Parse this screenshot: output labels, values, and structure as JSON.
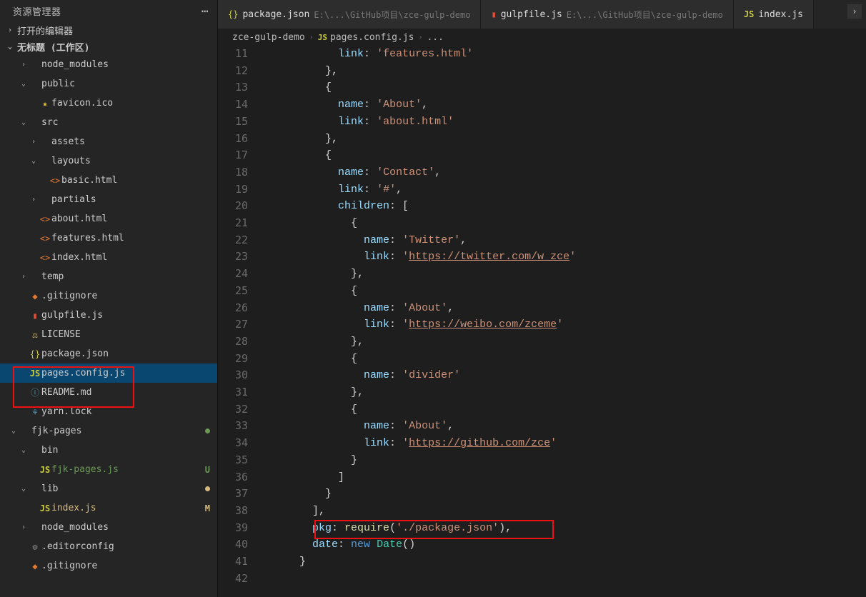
{
  "sidebar": {
    "title": "资源管理器",
    "openEditors": "打开的编辑器",
    "workspace": "无标题 (工作区)",
    "tree": [
      {
        "d": 1,
        "chev": ">",
        "icon": "",
        "cls": "ic-folder",
        "label": "node_modules"
      },
      {
        "d": 1,
        "chev": "v",
        "icon": "",
        "cls": "ic-folder",
        "label": "public"
      },
      {
        "d": 2,
        "chev": "",
        "icon": "★",
        "cls": "ic-star",
        "label": "favicon.ico"
      },
      {
        "d": 1,
        "chev": "v",
        "icon": "",
        "cls": "ic-folder",
        "label": "src"
      },
      {
        "d": 2,
        "chev": ">",
        "icon": "",
        "cls": "ic-folder",
        "label": "assets"
      },
      {
        "d": 2,
        "chev": "v",
        "icon": "",
        "cls": "ic-folder",
        "label": "layouts"
      },
      {
        "d": 3,
        "chev": "",
        "icon": "<>",
        "cls": "ic-html",
        "label": "basic.html"
      },
      {
        "d": 2,
        "chev": ">",
        "icon": "",
        "cls": "ic-folder",
        "label": "partials"
      },
      {
        "d": 2,
        "chev": "",
        "icon": "<>",
        "cls": "ic-html",
        "label": "about.html"
      },
      {
        "d": 2,
        "chev": "",
        "icon": "<>",
        "cls": "ic-html",
        "label": "features.html"
      },
      {
        "d": 2,
        "chev": "",
        "icon": "<>",
        "cls": "ic-html",
        "label": "index.html"
      },
      {
        "d": 1,
        "chev": ">",
        "icon": "",
        "cls": "ic-folder",
        "label": "temp"
      },
      {
        "d": 1,
        "chev": "",
        "icon": "◆",
        "cls": "ic-git",
        "label": ".gitignore"
      },
      {
        "d": 1,
        "chev": "",
        "icon": "▮",
        "cls": "ic-gulp",
        "label": "gulpfile.js"
      },
      {
        "d": 1,
        "chev": "",
        "icon": "⚖",
        "cls": "ic-license",
        "label": "LICENSE"
      },
      {
        "d": 1,
        "chev": "",
        "icon": "{}",
        "cls": "ic-json",
        "label": "package.json"
      },
      {
        "d": 1,
        "chev": "",
        "icon": "JS",
        "cls": "ic-js",
        "label": "pages.config.js",
        "selected": true
      },
      {
        "d": 1,
        "chev": "",
        "icon": "ⓘ",
        "cls": "ic-md",
        "label": "README.md"
      },
      {
        "d": 1,
        "chev": "",
        "icon": "⚘",
        "cls": "ic-yarn",
        "label": "yarn.lock"
      },
      {
        "d": 0,
        "chev": "v",
        "icon": "",
        "cls": "ic-folder",
        "label": "fjk-pages",
        "badge": "dot",
        "badgeColor": "#6a9955"
      },
      {
        "d": 1,
        "chev": "v",
        "icon": "",
        "cls": "ic-folder",
        "label": "bin"
      },
      {
        "d": 2,
        "chev": "",
        "icon": "JS",
        "cls": "ic-js",
        "label": "fjk-pages.js",
        "badge": "U",
        "badgeColor": "#6a9955",
        "labelColor": "#6a9955"
      },
      {
        "d": 1,
        "chev": "v",
        "icon": "",
        "cls": "ic-folder",
        "label": "lib",
        "badge": "dot",
        "badgeColor": "#d7ba7d"
      },
      {
        "d": 2,
        "chev": "",
        "icon": "JS",
        "cls": "ic-js",
        "label": "index.js",
        "badge": "M",
        "badgeColor": "#d7ba7d",
        "labelColor": "#d7ba7d"
      },
      {
        "d": 1,
        "chev": ">",
        "icon": "",
        "cls": "ic-folder",
        "label": "node_modules"
      },
      {
        "d": 1,
        "chev": "",
        "icon": "⚙",
        "cls": "ic-gear",
        "label": ".editorconfig"
      },
      {
        "d": 1,
        "chev": "",
        "icon": "◆",
        "cls": "ic-git",
        "label": ".gitignore"
      }
    ]
  },
  "tabs": [
    {
      "icon": "{}",
      "iconCls": "ic-json",
      "label": "package.json",
      "path": "E:\\...\\GitHub项目\\zce-gulp-demo",
      "active": false
    },
    {
      "icon": "▮",
      "iconCls": "ic-gulp",
      "label": "gulpfile.js",
      "path": "E:\\...\\GitHub项目\\zce-gulp-demo",
      "active": false
    },
    {
      "icon": "JS",
      "iconCls": "ic-js",
      "label": "index.js",
      "path": "",
      "active": false
    }
  ],
  "breadcrumb": {
    "items": [
      {
        "label": "zce-gulp-demo"
      },
      {
        "icon": "JS",
        "iconCls": "ic-js",
        "label": "pages.config.js"
      },
      {
        "label": "..."
      }
    ]
  },
  "code": {
    "startLine": 11,
    "lines": [
      [
        [
          "            ",
          ""
        ],
        [
          "link",
          1
        ],
        [
          ": ",
          ""
        ],
        [
          "'features.html'",
          2
        ]
      ],
      [
        [
          "          },",
          ""
        ]
      ],
      [
        [
          "          {",
          ""
        ]
      ],
      [
        [
          "            ",
          ""
        ],
        [
          "name",
          1
        ],
        [
          ": ",
          ""
        ],
        [
          "'About'",
          2
        ],
        [
          ",",
          ""
        ]
      ],
      [
        [
          "            ",
          ""
        ],
        [
          "link",
          1
        ],
        [
          ": ",
          ""
        ],
        [
          "'about.html'",
          2
        ]
      ],
      [
        [
          "          },",
          ""
        ]
      ],
      [
        [
          "          {",
          ""
        ]
      ],
      [
        [
          "            ",
          ""
        ],
        [
          "name",
          1
        ],
        [
          ": ",
          ""
        ],
        [
          "'Contact'",
          2
        ],
        [
          ",",
          ""
        ]
      ],
      [
        [
          "            ",
          ""
        ],
        [
          "link",
          1
        ],
        [
          ": ",
          ""
        ],
        [
          "'#'",
          2
        ],
        [
          ",",
          ""
        ]
      ],
      [
        [
          "            ",
          ""
        ],
        [
          "children",
          1
        ],
        [
          ": [",
          ""
        ]
      ],
      [
        [
          "              {",
          ""
        ]
      ],
      [
        [
          "                ",
          ""
        ],
        [
          "name",
          1
        ],
        [
          ": ",
          ""
        ],
        [
          "'Twitter'",
          2
        ],
        [
          ",",
          ""
        ]
      ],
      [
        [
          "                ",
          ""
        ],
        [
          "link",
          1
        ],
        [
          ": ",
          ""
        ],
        [
          "'",
          2
        ],
        [
          "https://twitter.com/w_zce",
          3
        ],
        [
          "'",
          2
        ]
      ],
      [
        [
          "              },",
          ""
        ]
      ],
      [
        [
          "              {",
          ""
        ]
      ],
      [
        [
          "                ",
          ""
        ],
        [
          "name",
          1
        ],
        [
          ": ",
          ""
        ],
        [
          "'About'",
          2
        ],
        [
          ",",
          ""
        ]
      ],
      [
        [
          "                ",
          ""
        ],
        [
          "link",
          1
        ],
        [
          ": ",
          ""
        ],
        [
          "'",
          2
        ],
        [
          "https://weibo.com/zceme",
          3
        ],
        [
          "'",
          2
        ]
      ],
      [
        [
          "              },",
          ""
        ]
      ],
      [
        [
          "              {",
          ""
        ]
      ],
      [
        [
          "                ",
          ""
        ],
        [
          "name",
          1
        ],
        [
          ": ",
          ""
        ],
        [
          "'divider'",
          2
        ]
      ],
      [
        [
          "              },",
          ""
        ]
      ],
      [
        [
          "              {",
          ""
        ]
      ],
      [
        [
          "                ",
          ""
        ],
        [
          "name",
          1
        ],
        [
          ": ",
          ""
        ],
        [
          "'About'",
          2
        ],
        [
          ",",
          ""
        ]
      ],
      [
        [
          "                ",
          ""
        ],
        [
          "link",
          1
        ],
        [
          ": ",
          ""
        ],
        [
          "'",
          2
        ],
        [
          "https://github.com/zce",
          3
        ],
        [
          "'",
          2
        ]
      ],
      [
        [
          "              }",
          ""
        ]
      ],
      [
        [
          "            ]",
          ""
        ]
      ],
      [
        [
          "          }",
          ""
        ]
      ],
      [
        [
          "        ],",
          ""
        ]
      ],
      [
        [
          "        ",
          ""
        ],
        [
          "pkg",
          1
        ],
        [
          ": ",
          ""
        ],
        [
          "require",
          5
        ],
        [
          "(",
          ""
        ],
        [
          "'./package.json'",
          2
        ],
        [
          "),",
          ""
        ]
      ],
      [
        [
          "        ",
          ""
        ],
        [
          "date",
          1
        ],
        [
          ": ",
          ""
        ],
        [
          "new",
          4
        ],
        [
          " ",
          ""
        ],
        [
          "Date",
          6
        ],
        [
          "()",
          ""
        ]
      ],
      [
        [
          "      }",
          ""
        ]
      ],
      [
        [
          "",
          ""
        ]
      ]
    ]
  }
}
